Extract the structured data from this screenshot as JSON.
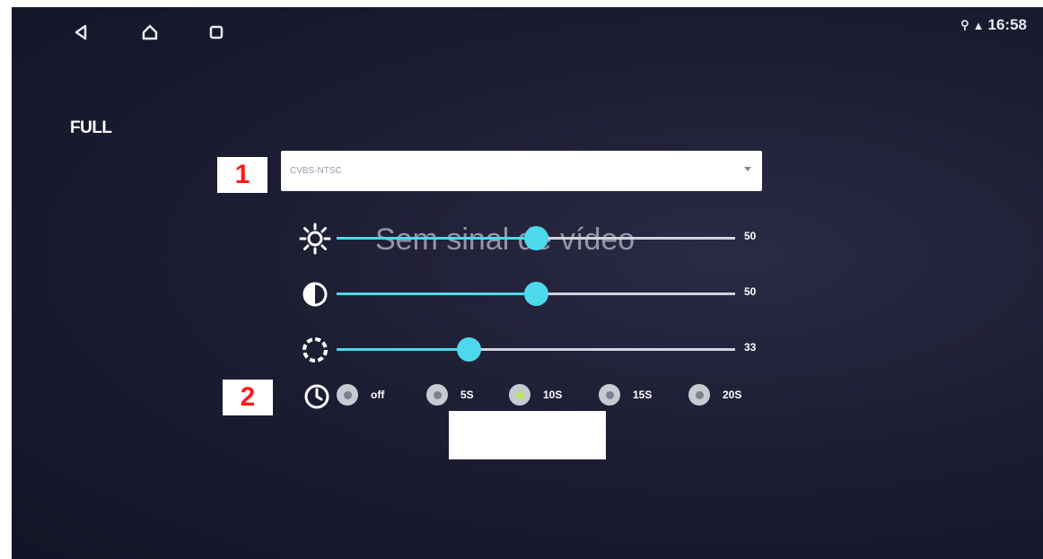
{
  "status_bar": {
    "time": "16:58"
  },
  "nav": {
    "back_icon": "back-triangle-icon",
    "home_icon": "home-icon",
    "recents_icon": "recents-square-icon"
  },
  "mode_label": "FULL",
  "no_signal_text": "Sem sinal de vídeo",
  "video_source": {
    "selected": "CVBS-NTSC"
  },
  "sliders": [
    {
      "name": "brightness",
      "icon": "brightness-sun-icon",
      "value": "50",
      "fraction": 0.5
    },
    {
      "name": "contrast",
      "icon": "contrast-icon",
      "value": "50",
      "fraction": 0.5
    },
    {
      "name": "saturation",
      "icon": "saturation-dashed-circle-icon",
      "value": "33",
      "fraction": 0.33
    }
  ],
  "timer": {
    "icon": "clock-icon",
    "options": [
      {
        "label": "off",
        "selected": false
      },
      {
        "label": "5S",
        "selected": false
      },
      {
        "label": "10S",
        "selected": true
      },
      {
        "label": "15S",
        "selected": false
      },
      {
        "label": "20S",
        "selected": false
      }
    ]
  },
  "ok_button": {
    "label": ""
  },
  "annotations": {
    "marker_1": "1",
    "marker_2": "2"
  },
  "colors": {
    "accent": "#4dd9ec",
    "selected_radio": "#b6e56a",
    "background": "#1d1d33",
    "marker_text": "#ff1a1a"
  }
}
